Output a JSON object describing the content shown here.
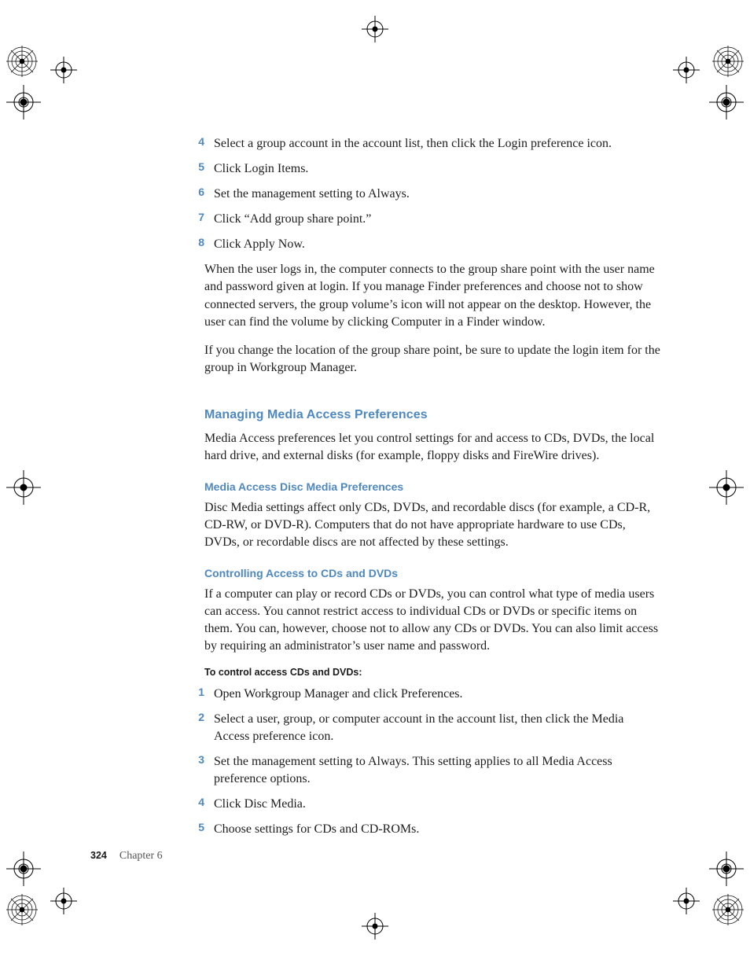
{
  "steps_a": [
    {
      "n": "4",
      "t": "Select a group account in the account list, then click the Login preference icon."
    },
    {
      "n": "5",
      "t": "Click Login Items."
    },
    {
      "n": "6",
      "t": "Set the management setting to Always."
    },
    {
      "n": "7",
      "t": "Click “Add group share point.”"
    },
    {
      "n": "8",
      "t": "Click Apply Now."
    }
  ],
  "after_steps_a": [
    "When the user logs in, the computer connects to the group share point with the user name and password given at login. If you manage Finder preferences and choose not to show connected servers, the group volume’s icon will not appear on the desktop. However, the user can find the volume by clicking Computer in a Finder window.",
    "If you change the location of the group share point, be sure to update the login item for the group in Workgroup Manager."
  ],
  "h2": "Managing Media Access Preferences",
  "h2_body": "Media Access preferences let you control settings for and access to CDs, DVDs, the local hard drive, and external disks (for example, floppy disks and FireWire drives).",
  "h3a": "Media Access Disc Media Preferences",
  "h3a_body": "Disc Media settings affect only CDs, DVDs, and recordable discs (for example, a CD-R, CD-RW, or DVD-R). Computers that do not have appropriate hardware to use CDs, DVDs, or recordable discs are not affected by these settings.",
  "h3b": "Controlling Access to CDs and DVDs",
  "h3b_body": "If a computer can play or record CDs or DVDs, you can control what type of media users can access. You cannot restrict access to individual CDs or DVDs or specific items on them. You can, however, choose not to allow any CDs or DVDs. You can also limit access by requiring an administrator’s user name and password.",
  "h4": "To control access CDs and DVDs:",
  "steps_b": [
    {
      "n": "1",
      "t": "Open Workgroup Manager and click Preferences."
    },
    {
      "n": "2",
      "t": "Select a user, group, or computer account in the account list, then click the Media Access preference icon."
    },
    {
      "n": "3",
      "t": "Set the management setting to Always. This setting applies to all Media Access preference options."
    },
    {
      "n": "4",
      "t": "Click Disc Media."
    },
    {
      "n": "5",
      "t": "Choose settings for CDs and CD-ROMs."
    }
  ],
  "footer": {
    "page": "324",
    "chapter": "Chapter 6"
  }
}
